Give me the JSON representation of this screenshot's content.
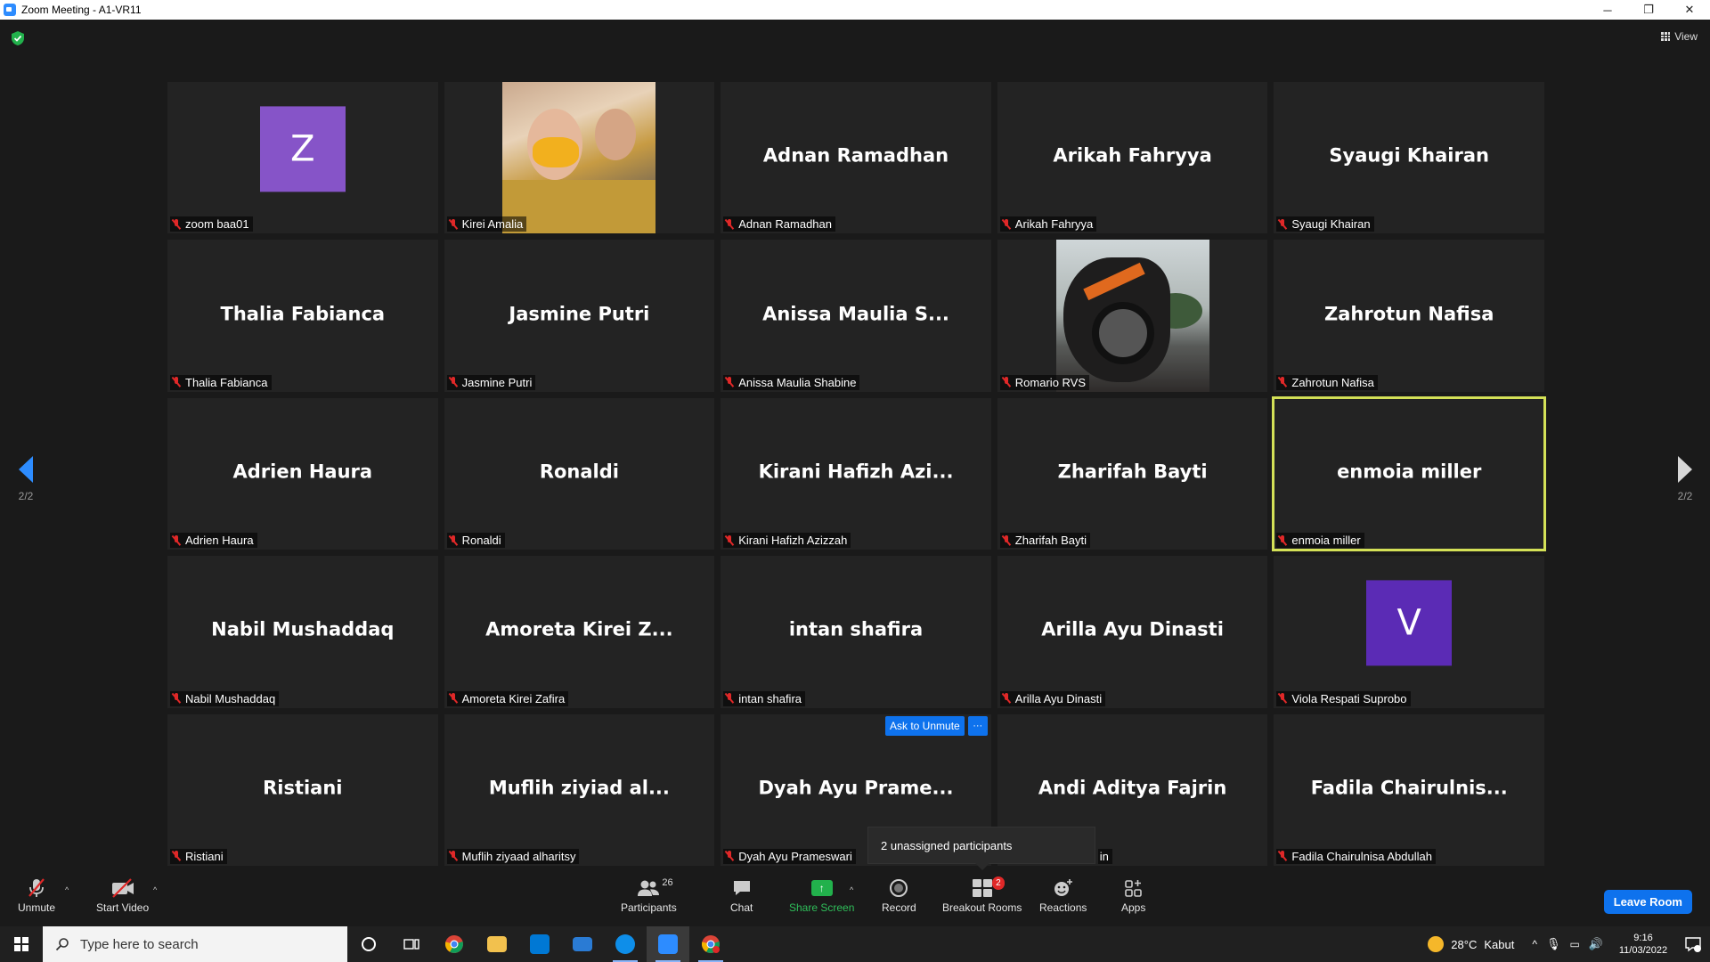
{
  "window": {
    "title": "Zoom Meeting - A1-VR11",
    "minimize": "─",
    "restore": "❐",
    "close": "✕"
  },
  "header": {
    "view_label": "View"
  },
  "pagination": {
    "left": "2/2",
    "right": "2/2"
  },
  "tiles": [
    {
      "big": "",
      "label": "zoom baa01",
      "avatar": "Z"
    },
    {
      "big": "",
      "label": "Kirei Amalia"
    },
    {
      "big": "Adnan Ramadhan",
      "label": "Adnan Ramadhan"
    },
    {
      "big": "Arikah Fahryya",
      "label": "Arikah Fahryya"
    },
    {
      "big": "Syaugi Khairan",
      "label": "Syaugi Khairan"
    },
    {
      "big": "Thalia Fabianca",
      "label": "Thalia Fabianca"
    },
    {
      "big": "Jasmine Putri",
      "label": "Jasmine Putri"
    },
    {
      "big": "Anissa Maulia S...",
      "label": "Anissa Maulia Shabine"
    },
    {
      "big": "",
      "label": "Romario RVS"
    },
    {
      "big": "Zahrotun Nafisa",
      "label": "Zahrotun Nafisa"
    },
    {
      "big": "Adrien Haura",
      "label": "Adrien Haura"
    },
    {
      "big": "Ronaldi",
      "label": "Ronaldi"
    },
    {
      "big": "Kirani Hafizh Azi...",
      "label": "Kirani Hafizh Azizzah"
    },
    {
      "big": "Zharifah Bayti",
      "label": "Zharifah Bayti"
    },
    {
      "big": "enmoia miller",
      "label": "enmoia miller"
    },
    {
      "big": "Nabil Mushaddaq",
      "label": "Nabil Mushaddaq"
    },
    {
      "big": "Amoreta Kirei Z...",
      "label": "Amoreta Kirei Zafira"
    },
    {
      "big": "intan shafira",
      "label": "intan shafira"
    },
    {
      "big": "Arilla Ayu Dinasti",
      "label": "Arilla Ayu Dinasti"
    },
    {
      "big": "",
      "label": "Viola Respati Suprobo",
      "avatar": "V"
    },
    {
      "big": "Ristiani",
      "label": "Ristiani"
    },
    {
      "big": "Muflih ziyiad al...",
      "label": "Muflih ziyaad alharitsy"
    },
    {
      "big": "Dyah Ayu Prame...",
      "label": "Dyah Ayu Prameswari"
    },
    {
      "big": "Andi Aditya Fajrin",
      "label": "in"
    },
    {
      "big": "Fadila Chairulnis...",
      "label": "Fadila Chairulnisa Abdullah"
    }
  ],
  "popover": {
    "ask_unmute": "Ask to Unmute",
    "more": "···"
  },
  "unassigned": "2 unassigned participants",
  "toolbar": {
    "unmute": "Unmute",
    "start_video": "Start Video",
    "participants": "Participants",
    "participants_count": "26",
    "chat": "Chat",
    "share_screen": "Share Screen",
    "record": "Record",
    "breakout_rooms": "Breakout Rooms",
    "breakout_badge": "2",
    "reactions": "Reactions",
    "apps": "Apps",
    "leave": "Leave Room"
  },
  "taskbar": {
    "search_placeholder": "Type here to search",
    "temperature": "28°C",
    "weather": "Kabut",
    "time": "9:16",
    "date": "11/03/2022",
    "notif_count": "1"
  },
  "colors": {
    "accent": "#0e72ed",
    "active_speaker": "#d4e157",
    "muted": "#e02828",
    "share": "#22b14c"
  }
}
